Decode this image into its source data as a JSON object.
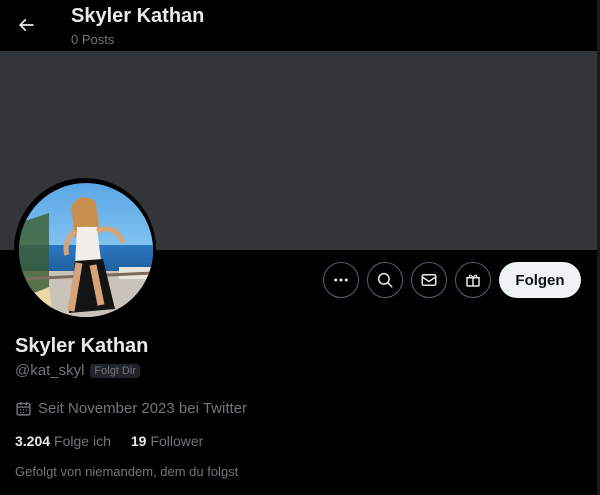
{
  "header": {
    "title": "Skyler Kathan",
    "posts_count": "0 Posts"
  },
  "profile": {
    "name": "Skyler Kathan",
    "handle": "@kat_skyl",
    "follows_you_badge": "Folgt Dir",
    "joined": "Seit November 2023 bei Twitter",
    "following_count": "3.204",
    "following_label": "Folge ich",
    "followers_count": "19",
    "followers_label": "Follower",
    "followed_by_text": "Gefolgt von niemandem, dem du folgst"
  },
  "actions": {
    "follow_label": "Folgen",
    "icons": [
      "more-icon",
      "search-icon",
      "message-icon",
      "gift-icon"
    ]
  },
  "colors": {
    "background": "#000000",
    "banner": "#333639",
    "primary_text": "#e7e9ea",
    "secondary_text": "#71767b",
    "button_border": "#536471",
    "follow_button_bg": "#eff3f4"
  }
}
